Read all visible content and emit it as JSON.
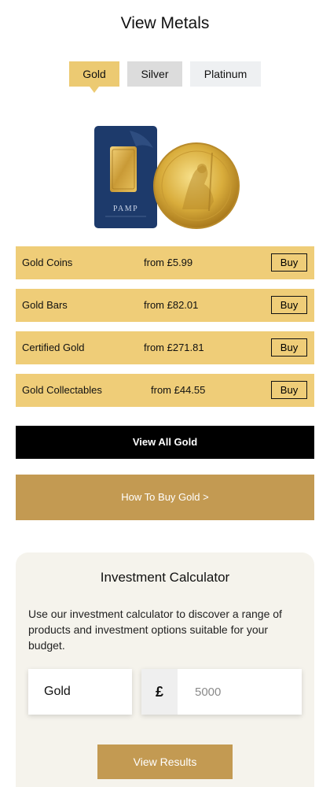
{
  "page": {
    "title": "View Metals"
  },
  "tabs": [
    {
      "label": "Gold",
      "active": true
    },
    {
      "label": "Silver",
      "active": false
    },
    {
      "label": "Platinum",
      "active": false
    }
  ],
  "hero": {
    "bar_brand": "PAMP"
  },
  "products": [
    {
      "name": "Gold Coins",
      "price": "from £5.99",
      "buy": "Buy"
    },
    {
      "name": "Gold Bars",
      "price": "from £82.01",
      "buy": "Buy"
    },
    {
      "name": "Certified Gold",
      "price": "from £271.81",
      "buy": "Buy"
    },
    {
      "name": "Gold Collectables",
      "price": "from £44.55",
      "buy": "Buy"
    }
  ],
  "actions": {
    "view_all": "View All Gold",
    "how_to_buy": "How To Buy Gold >"
  },
  "calculator": {
    "title": "Investment Calculator",
    "description": "Use our investment calculator to discover a range of products and investment options suitable for your budget.",
    "metal": "Gold",
    "currency": "£",
    "amount_placeholder": "5000",
    "submit": "View Results"
  },
  "colors": {
    "gold": "#ecca72",
    "row": "#efcd78",
    "bronze": "#c39a52",
    "silver": "#dcdcdc",
    "platinum": "#eef0f2",
    "navy": "#1d3a6b"
  }
}
